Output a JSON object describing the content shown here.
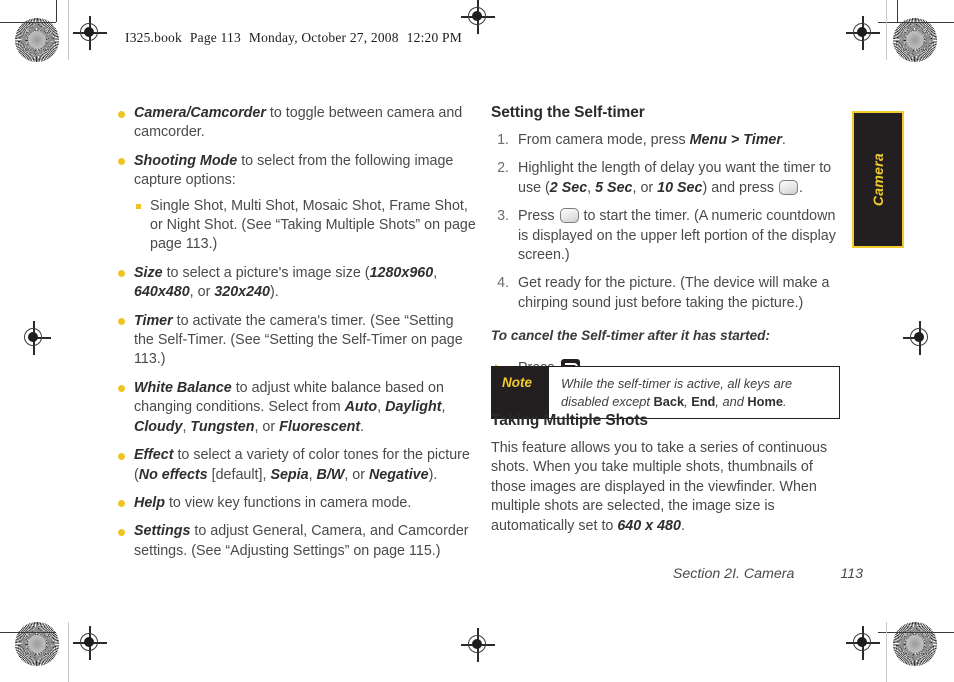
{
  "running_header": {
    "file": "I325.book",
    "page_label": "Page 113",
    "date": "Monday, October 27, 2008",
    "time": "12:20 PM"
  },
  "side_tab": {
    "label": "Camera",
    "background": "#231F20",
    "accent": "#F2CB2E"
  },
  "colors": {
    "bullet": "#EDC423",
    "accent": "#F2CB2E",
    "dark": "#231F20",
    "body_text": "#4a4a4a"
  },
  "left_column": {
    "bullets": [
      {
        "term": "Camera/Camcorder",
        "text": " to toggle between camera and camcorder."
      },
      {
        "term": "Shooting Mode",
        "text": " to select from the following image capture options:",
        "sub_bullets": [
          "Single Shot, Multi Shot, Mosaic Shot, Frame Shot, or Night Shot. (See “Taking Multiple Shots” on page page 113.)"
        ]
      },
      {
        "term": "Size",
        "text": " to select a picture's image size (1280x960, 640x480, or 320x240)."
      },
      {
        "term": "Timer",
        "text": " to activate the camera's timer. (See “Setting the Self-Timer. (See “Setting the Self-Timer on page 113.)"
      },
      {
        "term": "White Balance",
        "text": " to adjust white balance based on changing conditions. Select from Auto, Daylight, Cloudy, Tungsten, or Fluorescent."
      },
      {
        "term": "Effect",
        "text": " to select a variety of color tones for the picture (No effects [default], Sepia, B/W, or Negative)."
      },
      {
        "term": "Help",
        "text": " to view key functions in camera mode."
      },
      {
        "term": "Settings",
        "text": " to adjust General, Camera, and Camcorder settings. (See “Adjusting Settings” on page 115.)"
      }
    ]
  },
  "right_column": {
    "heading_self_timer": "Setting the Self-timer",
    "steps": [
      {
        "num": "1.",
        "text": "From camera mode, press Menu > Timer."
      },
      {
        "num": "2.",
        "text": "Highlight the length of delay you want the timer to use (2 Sec, 5 Sec, or 10 Sec) and press [OK key]."
      },
      {
        "num": "3.",
        "text": "Press [OK key] to start the timer. (A numeric countdown is displayed on the upper left portion of the display screen.)"
      },
      {
        "num": "4.",
        "text": "Get ready for the picture. (The device will make a chirping sound just before taking the picture.)"
      }
    ],
    "cancel_lead_in": "To cancel the Self-timer after it has started:",
    "cancel_step": "Press",
    "note": {
      "label": "Note",
      "text_before": "While the self-timer is active, all keys are disabled except ",
      "keys": [
        "Back",
        "End",
        "Home"
      ],
      "full_text": "While the self-timer is active, all keys are disabled except Back, End, and Home."
    },
    "heading_multiple_shots": "Taking Multiple Shots",
    "multiple_shots_paragraph": "This feature allows you to take a series of continuous shots. When you take multiple shots, thumbnails of those images are displayed in the viewfinder. When multiple shots are selected, the image size is automatically set to 640 x 480."
  },
  "footer": {
    "section": "Section 2I. Camera",
    "page_number": "113"
  }
}
